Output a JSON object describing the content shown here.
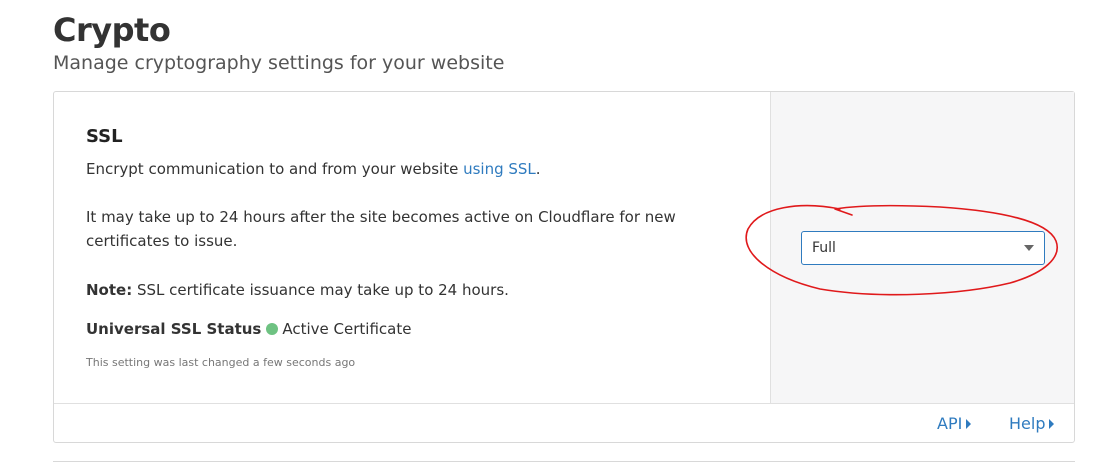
{
  "page": {
    "title": "Crypto",
    "subtitle": "Manage cryptography settings for your website"
  },
  "ssl": {
    "title": "SSL",
    "description_prefix": "Encrypt communication to and from your website ",
    "description_link": "using SSL",
    "description_suffix": ".",
    "activation_note": "It may take up to 24 hours after the site becomes active on Cloudflare for new certificates to issue.",
    "note_label": "Note:",
    "note_text": " SSL certificate issuance may take up to 24 hours.",
    "status_label": "Universal SSL Status",
    "status_value": "Active Certificate",
    "last_changed": "This setting was last changed a few seconds ago",
    "mode_select": {
      "selected": "Full"
    }
  },
  "footer": {
    "api_label": "API",
    "help_label": "Help"
  },
  "colors": {
    "link": "#2f7bbf",
    "status_active": "#6ec282",
    "annotation": "#e0191b"
  },
  "icons": {
    "status": "green-dot-icon",
    "dropdown": "chevron-down-icon",
    "footer_links": "caret-right-icon"
  }
}
